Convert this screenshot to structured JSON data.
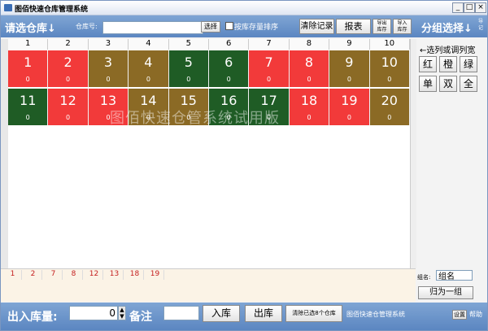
{
  "window": {
    "title": "图佰快速仓库管理系统",
    "min": "_",
    "max": "□",
    "close": "×"
  },
  "toolbar": {
    "select_warehouse": "请选仓库↓",
    "warehouse_no_label": "仓库号:",
    "warehouse_no_value": "",
    "select_btn": "选择",
    "sort_label": "按库存量排序",
    "clear_btn": "清除记录",
    "report_btn": "报表",
    "export_btn": "导出\n库存",
    "import_btn": "导入\n库存",
    "group_select": "分组选择↓",
    "extra_label": "导\n记"
  },
  "grid": {
    "columns": [
      "1",
      "2",
      "3",
      "4",
      "5",
      "6",
      "7",
      "8",
      "9",
      "10"
    ],
    "rows": [
      [
        {
          "num": "1",
          "count": "0",
          "color": "#f23a3a"
        },
        {
          "num": "2",
          "count": "0",
          "color": "#f23a3a"
        },
        {
          "num": "3",
          "count": "0",
          "color": "#8b6a25"
        },
        {
          "num": "4",
          "count": "0",
          "color": "#8b6a25"
        },
        {
          "num": "5",
          "count": "0",
          "color": "#1f5c25"
        },
        {
          "num": "6",
          "count": "0",
          "color": "#1f5c25"
        },
        {
          "num": "7",
          "count": "0",
          "color": "#f23a3a"
        },
        {
          "num": "8",
          "count": "0",
          "color": "#f23a3a"
        },
        {
          "num": "9",
          "count": "0",
          "color": "#8b6a25"
        },
        {
          "num": "10",
          "count": "0",
          "color": "#8b6a25"
        }
      ],
      [
        {
          "num": "11",
          "count": "0",
          "color": "#1f5c25"
        },
        {
          "num": "12",
          "count": "0",
          "color": "#f23a3a"
        },
        {
          "num": "13",
          "count": "0",
          "color": "#f23a3a"
        },
        {
          "num": "14",
          "count": "0",
          "color": "#8b6a25"
        },
        {
          "num": "15",
          "count": "0",
          "color": "#8b6a25"
        },
        {
          "num": "16",
          "count": "0",
          "color": "#1f5c25"
        },
        {
          "num": "17",
          "count": "0",
          "color": "#1f5c25"
        },
        {
          "num": "18",
          "count": "0",
          "color": "#f23a3a"
        },
        {
          "num": "19",
          "count": "0",
          "color": "#f23a3a"
        },
        {
          "num": "20",
          "count": "0",
          "color": "#8b6a25"
        }
      ]
    ],
    "watermark": "图佰快速仓管系统试用版"
  },
  "right_panel": {
    "head": "←选列或调列宽",
    "buttons": [
      "红",
      "橙",
      "绿",
      "单",
      "双",
      "全"
    ],
    "group_name_label": "组名:",
    "group_name_value": "组名",
    "group_btn": "归为一组"
  },
  "tabs": [
    "1",
    "2",
    "7",
    "8",
    "12",
    "13",
    "18",
    "19"
  ],
  "footer": {
    "qty_label": "出入库量:",
    "qty_value": "0",
    "remark_label": "备注",
    "remark_value": "",
    "in_btn": "入库",
    "out_btn": "出库",
    "clear_selected_btn": "清除已选8个仓库",
    "app_name": "图佰快速仓管理系统",
    "help": "帮助",
    "settings": "设置"
  },
  "colors": {
    "red": "#f23a3a",
    "olive": "#8b6a25",
    "green": "#1f5c25",
    "toolbar_blue": "#6b93c9"
  }
}
